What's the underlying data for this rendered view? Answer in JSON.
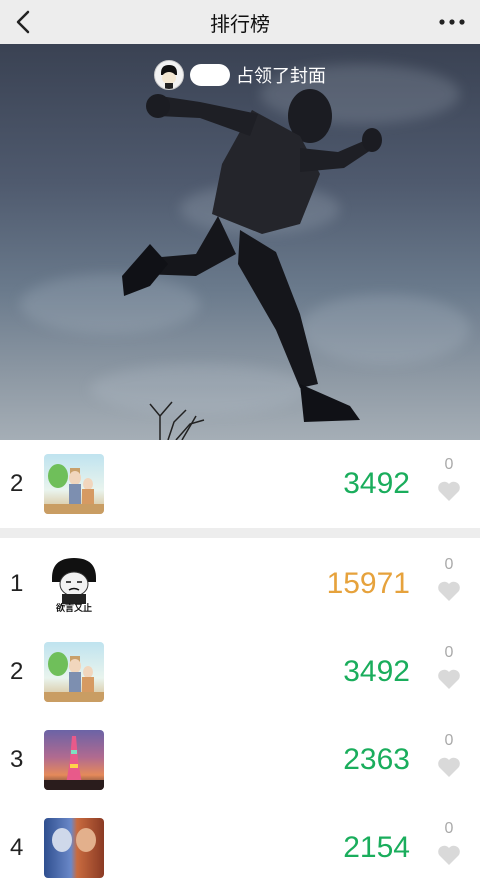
{
  "nav": {
    "title": "排行榜",
    "back_icon": "chevron-left-icon",
    "more_icon": "more-dots-icon"
  },
  "cover": {
    "banner_text": "占领了封面"
  },
  "my_rank": {
    "rank": "2",
    "steps": "3492",
    "likes": "0",
    "steps_color": "#1aad5c",
    "avatar": "couple-avatar"
  },
  "rankings": [
    {
      "rank": "1",
      "steps": "15971",
      "likes": "0",
      "steps_color": "#e6a23c",
      "avatar": "meme-avatar",
      "avatar_caption": "欲言又止"
    },
    {
      "rank": "2",
      "steps": "3492",
      "likes": "0",
      "steps_color": "#1aad5c",
      "avatar": "couple-avatar"
    },
    {
      "rank": "3",
      "steps": "2363",
      "likes": "0",
      "steps_color": "#1aad5c",
      "avatar": "tower-avatar"
    },
    {
      "rank": "4",
      "steps": "2154",
      "likes": "0",
      "steps_color": "#1aad5c",
      "avatar": "game-avatar"
    }
  ]
}
